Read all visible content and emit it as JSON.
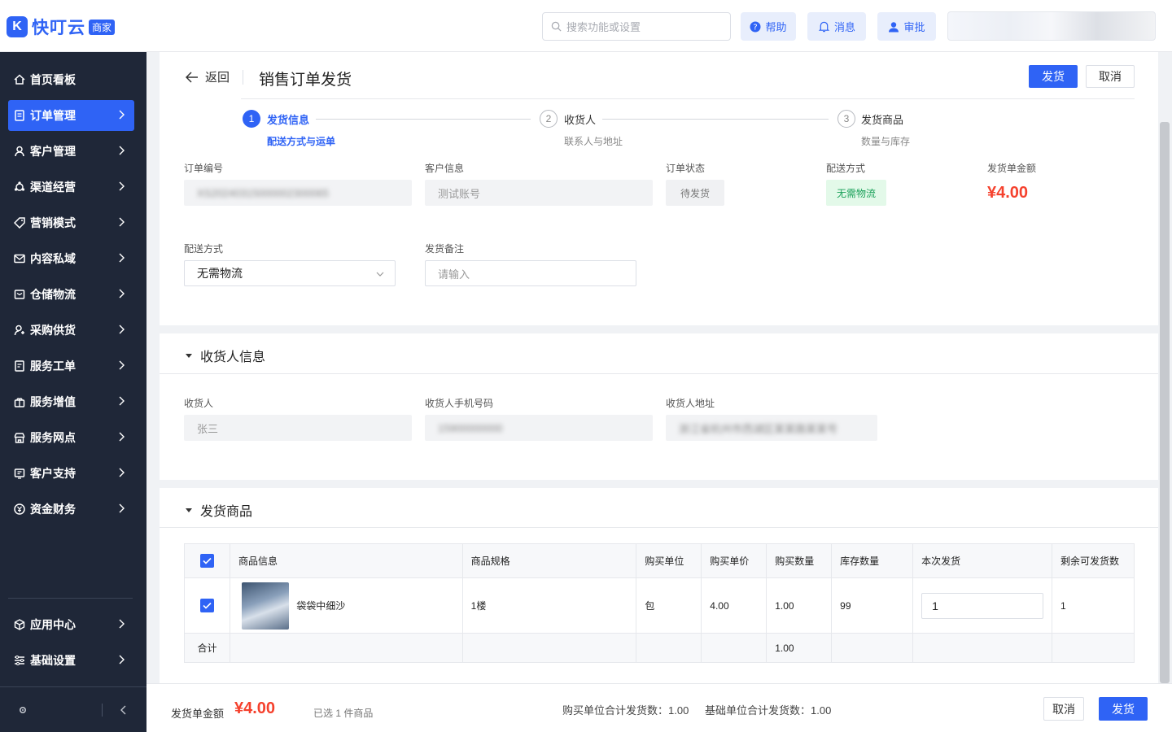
{
  "brand": {
    "mark": "K",
    "name": "快叮云",
    "badge": "商家"
  },
  "header": {
    "search_placeholder": "搜索功能或设置",
    "help": "帮助",
    "messages": "消息",
    "approve": "审批"
  },
  "sidebar": {
    "items": [
      {
        "label": "首页看板",
        "icon": "home-icon",
        "has_chevron": false
      },
      {
        "label": "订单管理",
        "icon": "order-icon",
        "has_chevron": true,
        "active": true
      },
      {
        "label": "客户管理",
        "icon": "user-icon",
        "has_chevron": true
      },
      {
        "label": "渠道经营",
        "icon": "channel-icon",
        "has_chevron": true
      },
      {
        "label": "营销模式",
        "icon": "tag-icon",
        "has_chevron": true
      },
      {
        "label": "内容私域",
        "icon": "mail-icon",
        "has_chevron": true
      },
      {
        "label": "仓储物流",
        "icon": "warehouse-icon",
        "has_chevron": true
      },
      {
        "label": "采购供货",
        "icon": "purchase-icon",
        "has_chevron": true
      },
      {
        "label": "服务工单",
        "icon": "ticket-icon",
        "has_chevron": true
      },
      {
        "label": "服务增值",
        "icon": "gift-icon",
        "has_chevron": true
      },
      {
        "label": "服务网点",
        "icon": "store-icon",
        "has_chevron": true
      },
      {
        "label": "客户支持",
        "icon": "support-icon",
        "has_chevron": true
      },
      {
        "label": "资金财务",
        "icon": "finance-icon",
        "has_chevron": true
      }
    ],
    "bottom_items": [
      {
        "label": "应用中心",
        "icon": "cube-icon"
      },
      {
        "label": "基础设置",
        "icon": "settings-list-icon"
      }
    ]
  },
  "page": {
    "back": "返回",
    "title": "销售订单发货",
    "ship_button": "发货",
    "cancel_button": "取消"
  },
  "steps": [
    {
      "num": "1",
      "title": "发货信息",
      "sub": "配送方式与运单",
      "active": true
    },
    {
      "num": "2",
      "title": "收货人",
      "sub": "联系人与地址",
      "active": false
    },
    {
      "num": "3",
      "title": "发货商品",
      "sub": "数量与库存",
      "active": false
    }
  ],
  "order": {
    "order_no_label": "订单编号",
    "order_no_value": "XS20240315000002300065",
    "customer_label": "客户信息",
    "customer_value": "测试账号",
    "status_label": "订单状态",
    "status_value": "待发货",
    "delivery_label": "配送方式",
    "delivery_value": "无需物流",
    "amount_label": "发货单金额",
    "amount_value": "¥4.00",
    "delivery_select_label": "配送方式",
    "delivery_select_value": "无需物流",
    "remark_label": "发货备注",
    "remark_placeholder": "请输入"
  },
  "consignee": {
    "section_title": "收货人信息",
    "name_label": "收货人",
    "name_value": "张三",
    "phone_label": "收货人手机号码",
    "phone_value": "15900000000",
    "address_label": "收货人地址",
    "address_value": "浙江省杭州市西湖区某某路某某号"
  },
  "goods": {
    "section_title": "发货商品",
    "columns": [
      "商品信息",
      "商品规格",
      "购买单位",
      "购买单价",
      "购买数量",
      "库存数量",
      "本次发货",
      "剩余可发货数"
    ],
    "rows": [
      {
        "name": "袋袋中细沙",
        "spec": "1楼",
        "unit": "包",
        "price": "4.00",
        "qty": "1.00",
        "stock": "99",
        "ship": "1",
        "remain": "1"
      }
    ],
    "total_label": "合计",
    "total_qty": "1.00"
  },
  "footer": {
    "amount_label": "发货单金额",
    "amount": "¥4.00",
    "selected": "已选 1 件商品",
    "buy_unit_total": "购买单位合计发货数：1.00",
    "base_unit_total": "基础单位合计发货数：1.00",
    "cancel": "取消",
    "ship": "发货"
  },
  "colors": {
    "primary": "#2f63f5",
    "price": "#f5412d",
    "success": "#18a058",
    "sidebar_bg": "#1f2738"
  }
}
